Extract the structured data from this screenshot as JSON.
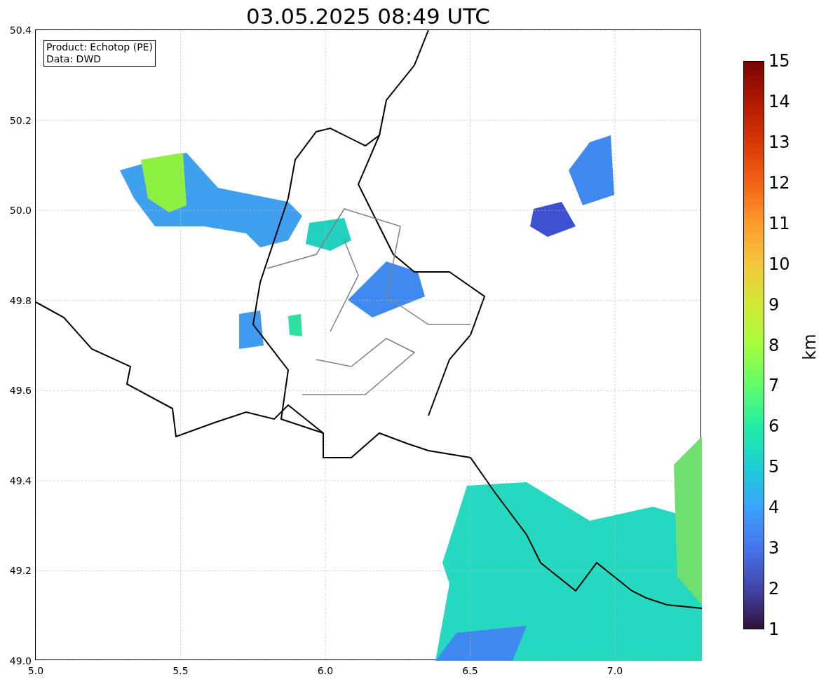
{
  "title": "03.05.2025 08:49 UTC",
  "info_box": [
    "Product: Echotop (PE)",
    "Data: DWD"
  ],
  "y_ticks": [
    "50.4",
    "50.2",
    "50.0",
    "49.8",
    "49.6",
    "49.4",
    "49.2",
    "49.0"
  ],
  "x_ticks": [
    "5.0",
    "5.5",
    "6.0",
    "6.5",
    "7.0"
  ],
  "colorbar": {
    "label": "km",
    "ticks": [
      "15",
      "14",
      "13",
      "12",
      "11",
      "10",
      "9",
      "8",
      "7",
      "6",
      "5",
      "4",
      "3",
      "2",
      "1"
    ]
  }
}
